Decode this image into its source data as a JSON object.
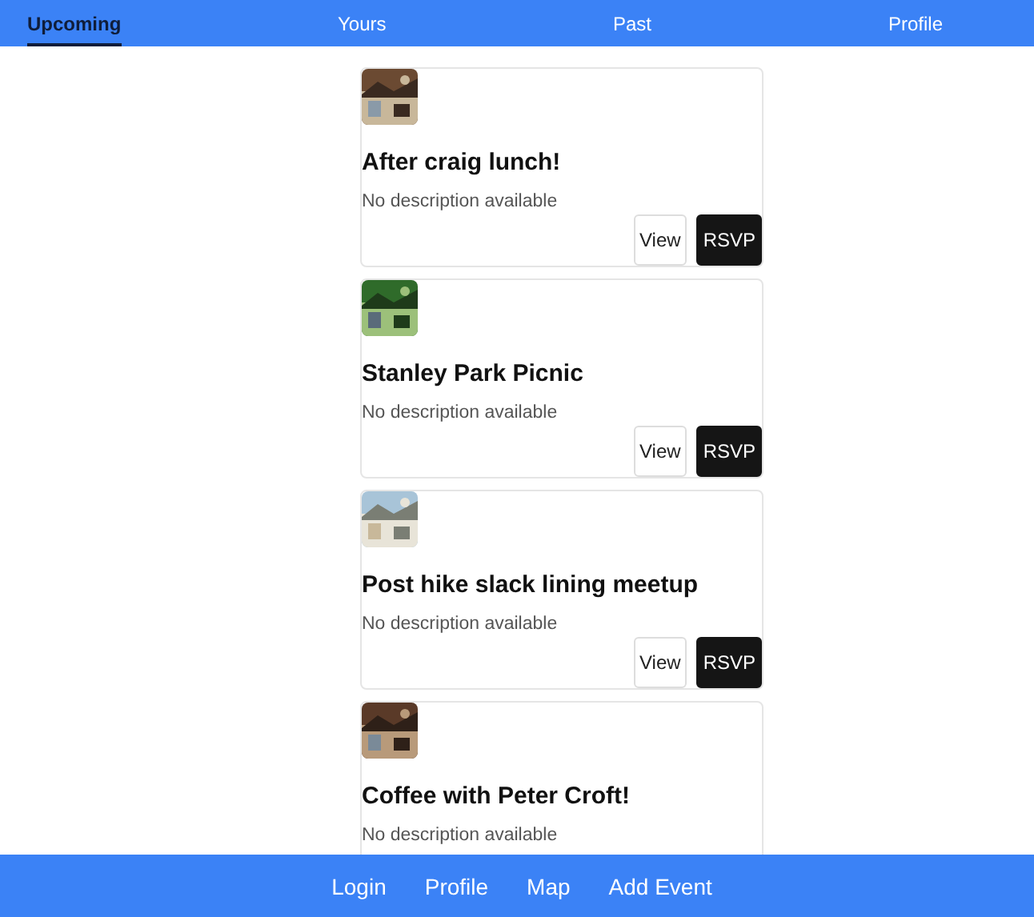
{
  "tabs": [
    {
      "label": "Upcoming",
      "selected": true
    },
    {
      "label": "Yours",
      "selected": false
    },
    {
      "label": "Past",
      "selected": false
    },
    {
      "label": "Profile",
      "selected": false
    }
  ],
  "events": [
    {
      "title": "After craig lunch!",
      "description": "No description available",
      "buttons": [
        {
          "label": "View",
          "kind": "outline"
        },
        {
          "label": "RSVP",
          "kind": "solid"
        }
      ]
    },
    {
      "title": "Stanley Park Picnic",
      "description": "No description available",
      "buttons": [
        {
          "label": "View",
          "kind": "outline"
        },
        {
          "label": "RSVP",
          "kind": "solid"
        }
      ]
    },
    {
      "title": "Post hike slack lining meetup",
      "description": "No description available",
      "buttons": [
        {
          "label": "View",
          "kind": "outline"
        },
        {
          "label": "RSVP",
          "kind": "solid"
        }
      ]
    },
    {
      "title": "Coffee with Peter Croft!",
      "description": "No description available"
    }
  ],
  "bottom_nav": [
    "Login",
    "Profile",
    "Map",
    "Add Event"
  ]
}
